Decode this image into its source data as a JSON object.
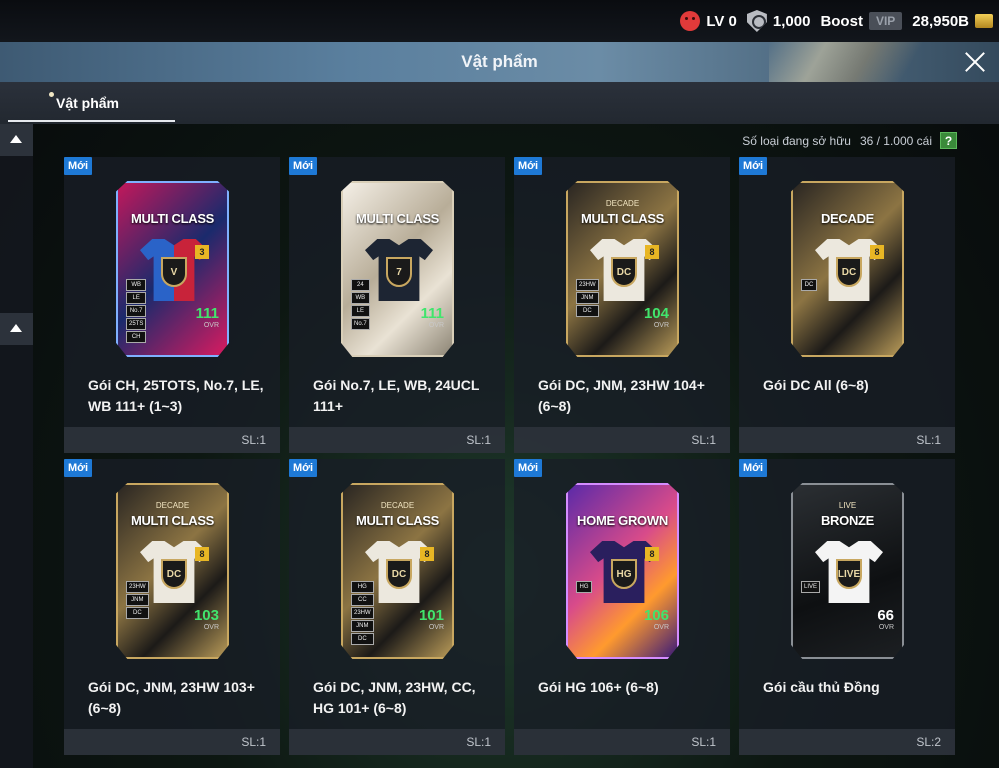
{
  "topbar": {
    "level": "LV 0",
    "shield_count": "1,000",
    "boost_label": "Boost",
    "vip_label": "VIP",
    "currency": "28,950B"
  },
  "header": {
    "title": "Vật phẩm"
  },
  "tabs": [
    {
      "label": "Vật phẩm"
    }
  ],
  "owned": {
    "label": "Số loại đang sở hữu",
    "value": "36 / 1.000 cái",
    "help": "?"
  },
  "colors": {
    "new_badge": "#1e79d6",
    "ovr_up": "#41e56d",
    "card_border": "#c8a760"
  },
  "items": [
    {
      "new": "Mới",
      "card_title": "MULTI CLASS",
      "card_sub": "",
      "num": "3",
      "shirt_mark": "V",
      "chips": [
        "WB",
        "LE",
        "No.7",
        "25TS",
        "CH"
      ],
      "ovr": "111",
      "ovr_label": "OVR",
      "name": "Gói CH, 25TOTS, No.7, LE, WB 111+ (1~3)",
      "qty": "SL:1",
      "theme": "tots"
    },
    {
      "new": "Mới",
      "card_title": "MULTI CLASS",
      "card_sub": "",
      "num": "",
      "shirt_mark": "7",
      "chips": [
        "24",
        "WB",
        "LE",
        "No.7"
      ],
      "ovr": "111",
      "ovr_label": "OVR",
      "name": "Gói No.7, LE, WB, 24UCL 111+",
      "qty": "SL:1",
      "theme": "silver"
    },
    {
      "new": "Mới",
      "card_title": "MULTI CLASS",
      "card_sub": "DECADE",
      "num": "8",
      "shirt_mark": "DC",
      "chips": [
        "23HW",
        "JNM",
        "DC"
      ],
      "ovr": "104",
      "ovr_label": "OVR",
      "name": "Gói DC, JNM, 23HW 104+ (6~8)",
      "qty": "SL:1",
      "theme": "decade"
    },
    {
      "new": "Mới",
      "card_title": "DECADE",
      "card_sub": "",
      "num": "8",
      "shirt_mark": "DC",
      "chips": [
        "DC"
      ],
      "ovr": "",
      "ovr_label": "",
      "name": "Gói DC All (6~8)",
      "qty": "SL:1",
      "theme": "decade"
    },
    {
      "new": "Mới",
      "card_title": "MULTI CLASS",
      "card_sub": "DECADE",
      "num": "8",
      "shirt_mark": "DC",
      "chips": [
        "23HW",
        "JNM",
        "DC"
      ],
      "ovr": "103",
      "ovr_label": "OVR",
      "name": "Gói DC, JNM, 23HW 103+ (6~8)",
      "qty": "SL:1",
      "theme": "decade"
    },
    {
      "new": "Mới",
      "card_title": "MULTI CLASS",
      "card_sub": "DECADE",
      "num": "8",
      "shirt_mark": "DC",
      "chips": [
        "HG",
        "CC",
        "23HW",
        "JNM",
        "DC"
      ],
      "ovr": "101",
      "ovr_label": "OVR",
      "name": "Gói DC, JNM, 23HW, CC, HG 101+ (6~8)",
      "qty": "SL:1",
      "theme": "decade"
    },
    {
      "new": "Mới",
      "card_title": "HOME GROWN",
      "card_sub": "",
      "num": "8",
      "shirt_mark": "HG",
      "chips": [
        "HG"
      ],
      "ovr": "106",
      "ovr_label": "OVR",
      "name": "Gói HG 106+ (6~8)",
      "qty": "SL:1",
      "theme": "homegrown"
    },
    {
      "new": "Mới",
      "card_title": "BRONZE",
      "card_sub": "LIVE",
      "num": "",
      "shirt_mark": "LIVE",
      "chips": [
        "LIVE"
      ],
      "ovr": "66",
      "ovr_label": "OVR",
      "name": "Gói cầu thủ Đồng",
      "qty": "SL:2",
      "theme": "live"
    }
  ]
}
